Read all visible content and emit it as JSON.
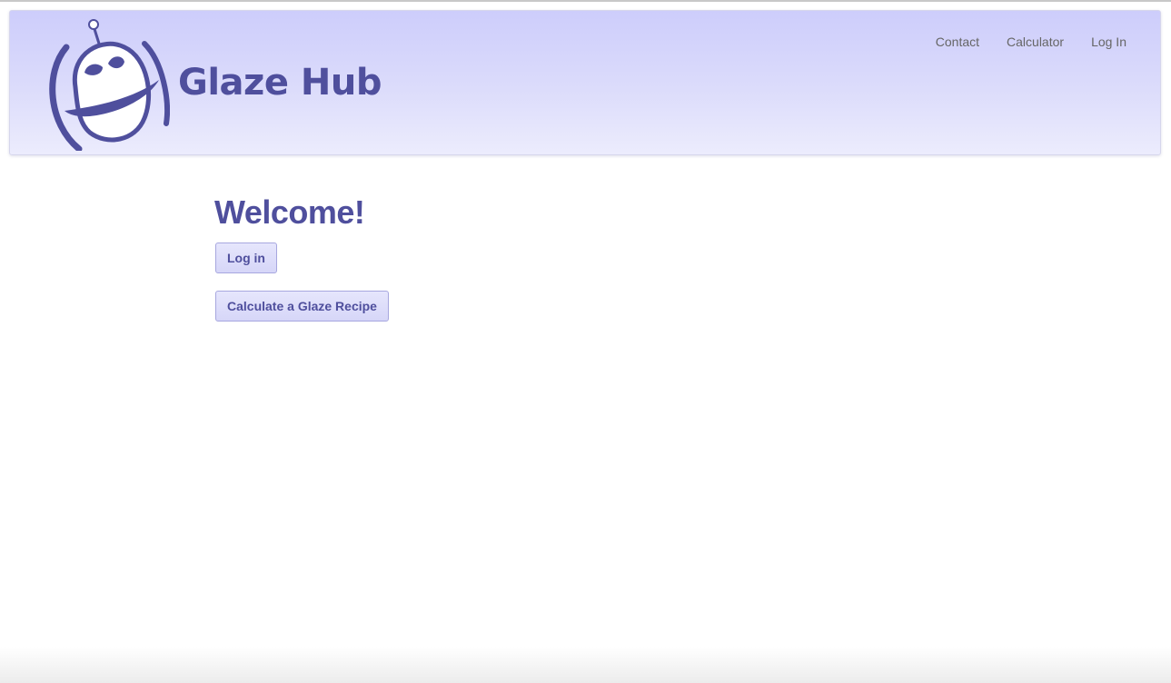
{
  "header": {
    "brand_name": "Glaze Hub",
    "nav": [
      {
        "label": "Contact"
      },
      {
        "label": "Calculator"
      },
      {
        "label": "Log In"
      }
    ]
  },
  "main": {
    "title": "Welcome!",
    "login_button": "Log in",
    "calculate_button": "Calculate a Glaze Recipe"
  },
  "colors": {
    "brand": "#4f4f9d",
    "header_top": "#cdcdfb",
    "header_bottom": "#ececfd",
    "nav_text": "#666666"
  },
  "icons": {
    "logo": "glaze-robot-logo-icon"
  }
}
